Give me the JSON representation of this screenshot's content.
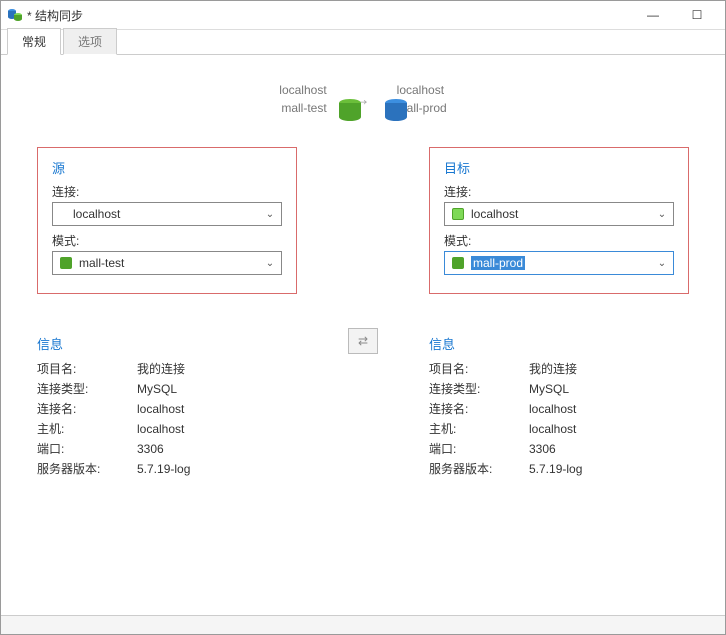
{
  "window": {
    "title": "* 结构同步"
  },
  "tabs": {
    "general": "常规",
    "options": "选项"
  },
  "summary": {
    "source_conn": "localhost",
    "source_schema": "mall-test",
    "target_conn": "localhost",
    "target_schema": "mall-prod"
  },
  "panel": {
    "source_title": "源",
    "target_title": "目标",
    "connection_label": "连接:",
    "schema_label": "模式:"
  },
  "source": {
    "connection": "localhost",
    "schema": "mall-test"
  },
  "target": {
    "connection": "localhost",
    "schema": "mall-prod"
  },
  "info": {
    "title": "信息",
    "labels": {
      "project": "项目名:",
      "conn_type": "连接类型:",
      "conn_name": "连接名:",
      "host": "主机:",
      "port": "端口:",
      "server_ver": "服务器版本:"
    },
    "source": {
      "project": "我的连接",
      "conn_type": "MySQL",
      "conn_name": "localhost",
      "host": "localhost",
      "port": "3306",
      "server_ver": "5.7.19-log"
    },
    "target": {
      "project": "我的连接",
      "conn_type": "MySQL",
      "conn_name": "localhost",
      "host": "localhost",
      "port": "3306",
      "server_ver": "5.7.19-log"
    }
  },
  "icons": {
    "app": "db-compare-icon",
    "arrow": "→",
    "swap": "⇄",
    "min": "—",
    "max": "☐",
    "caret": "⌄"
  }
}
